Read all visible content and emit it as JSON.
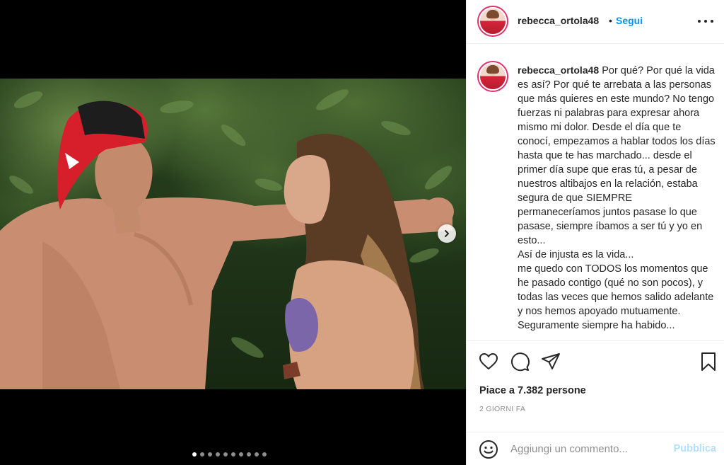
{
  "post": {
    "username": "rebecca_ortola48",
    "separator": "•",
    "follow_label": "Segui",
    "caption": "Por qué? Por qué la vida es así? Por qué te arrebata a las personas que más quieres en este mundo? No tengo fuerzas ni palabras para expresar ahora mismo mi dolor. Desde el día que te conocí, empezamos a hablar todos los días hasta que te has marchado... desde el primer día supe que eras tú, a pesar de nuestros altibajos en la relación, estaba segura de que SIEMPRE permaneceríamos juntos pasase lo que pasase, siempre íbamos a ser tú y yo en esto...\nAsí de injusta es la vida...\nme quedo con TODOS los momentos que he pasado contigo (qué no son pocos), y todas las veces que hemos salido adelante y nos hemos apoyado mutuamente.\nSeguramente siempre ha habido...",
    "likes_prefix": "Piace a ",
    "likes_count": "7.382",
    "likes_suffix": " persone",
    "time_ago": "2 GIORNI FA"
  },
  "comment_box": {
    "placeholder": "Aggiungi un commento...",
    "publish_label": "Pubblica"
  },
  "carousel": {
    "total_slides": 10,
    "active_index": 0
  },
  "colors": {
    "accent": "#0095f6",
    "publish_disabled": "#b2dffc",
    "text": "#262626",
    "muted": "#8e8e8e",
    "media_bg": "#000000"
  },
  "icons": [
    "heart-icon",
    "comment-icon",
    "share-icon",
    "bookmark-icon",
    "emoji-icon",
    "more-options-icon",
    "chevron-right-icon"
  ]
}
